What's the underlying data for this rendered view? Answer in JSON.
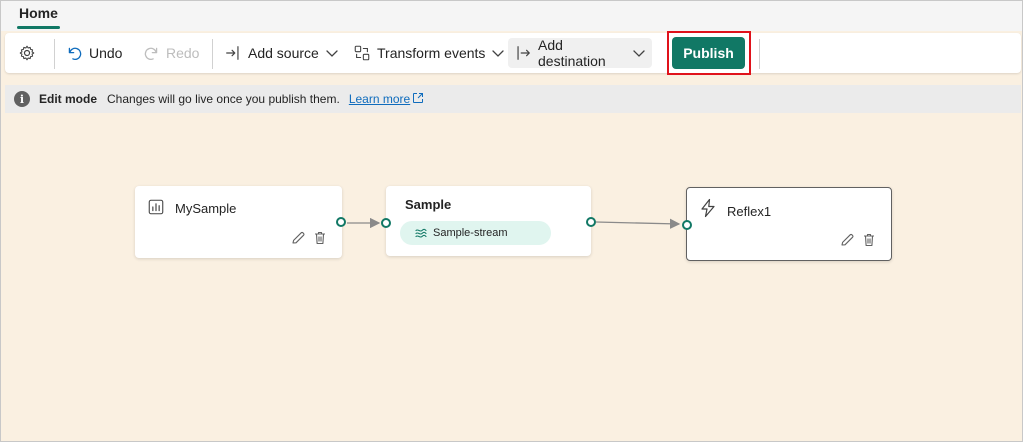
{
  "tabs": {
    "home": "Home"
  },
  "toolbar": {
    "settings_icon": "gear-icon",
    "undo_label": "Undo",
    "redo_label": "Redo",
    "add_source_label": "Add source",
    "transform_events_label": "Transform events",
    "add_destination_label": "Add destination",
    "publish_label": "Publish"
  },
  "edit_banner": {
    "title": "Edit mode",
    "message": "Changes will go live once you publish them.",
    "link": "Learn more"
  },
  "nodes": {
    "source": {
      "title": "MySample",
      "icon": "chart-icon"
    },
    "stream": {
      "title": "Sample",
      "stream_name": "Sample-stream"
    },
    "destination": {
      "title": "Reflex1",
      "icon": "lightning-icon"
    }
  },
  "colors": {
    "accent": "#117865",
    "canvas": "#faf0e1",
    "highlight": "#e0121b",
    "link": "#0f6cbd"
  }
}
